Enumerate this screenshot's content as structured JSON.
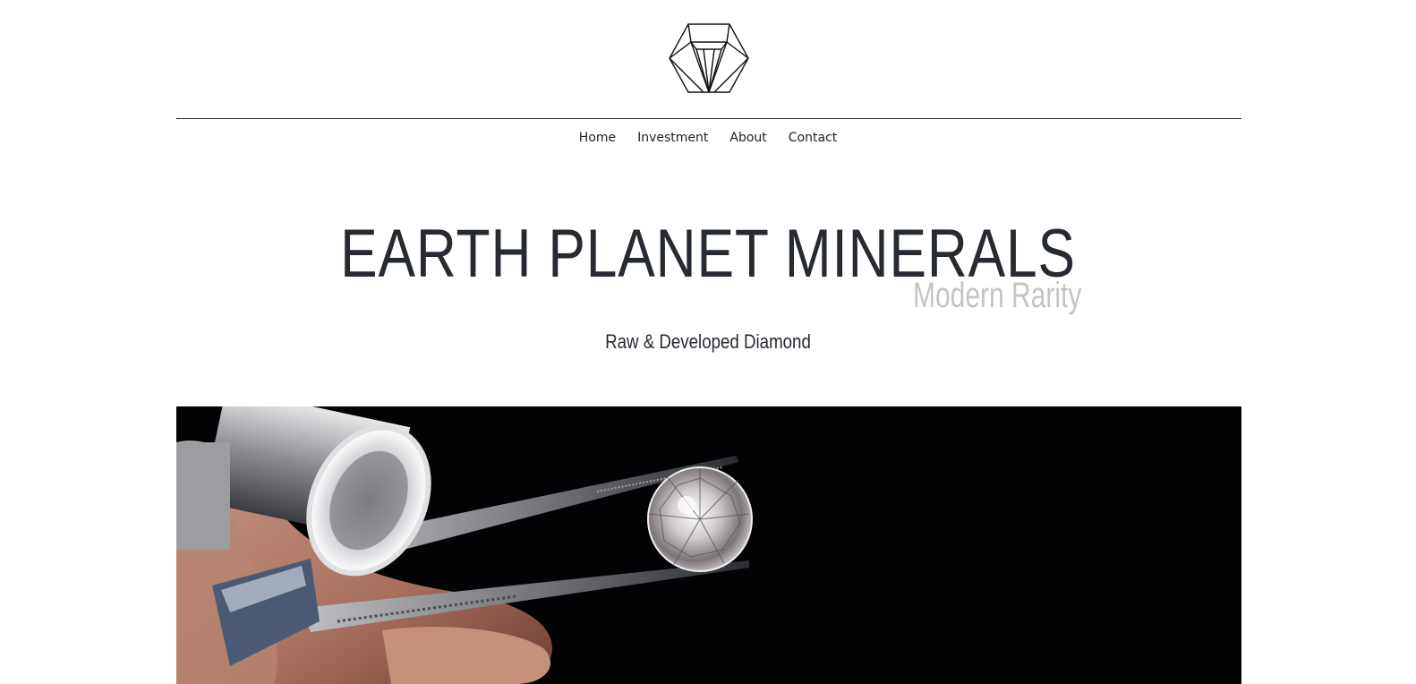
{
  "nav": {
    "items": [
      {
        "label": "Home"
      },
      {
        "label": "Investment"
      },
      {
        "label": "About"
      },
      {
        "label": "Contact"
      }
    ]
  },
  "hero": {
    "title": "EARTH PLANET MINERALS",
    "tagline": "Modern Rarity",
    "subtitle": "Raw & Developed Diamond"
  },
  "icons": {
    "logo": "diamond-logo-icon"
  },
  "colors": {
    "title": "#262a31",
    "tagline": "#c4c4c4",
    "hero_bg": "#030305",
    "divider": "#222222"
  }
}
